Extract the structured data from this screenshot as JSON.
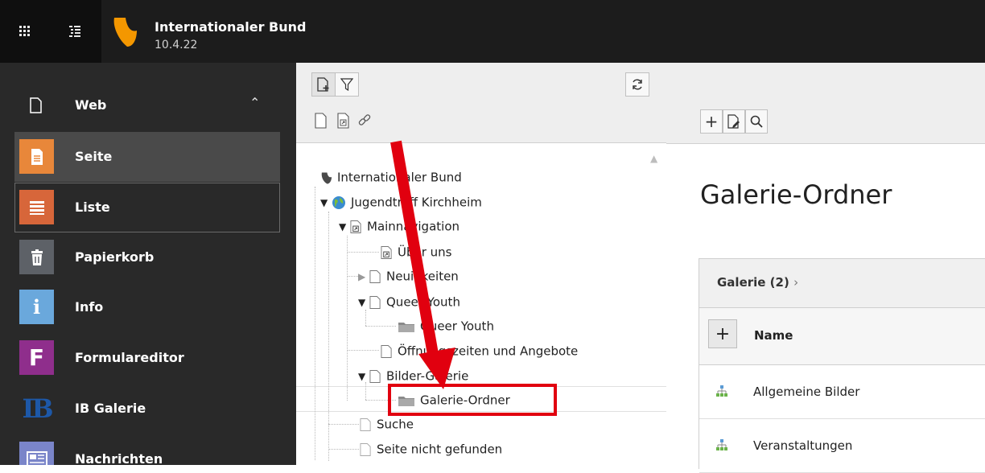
{
  "brand": {
    "name": "Internationaler Bund",
    "version": "10.4.22"
  },
  "colors": {
    "topbar": "#0f0f0f",
    "sidebar": "#292929",
    "accent_red": "#e1000f",
    "seite": "#e8873a",
    "liste": "#d7663a",
    "info": "#6aa8dc",
    "formulareditor": "#8f2e8c",
    "ib_galerie": "#1d58a8"
  },
  "sidebar": {
    "group": {
      "label": "Web",
      "icon": "page-icon",
      "expanded": true
    },
    "modules": [
      {
        "label": "Seite",
        "icon": "seite-icon",
        "state": "active"
      },
      {
        "label": "Liste",
        "icon": "liste-icon",
        "state": "hover"
      },
      {
        "label": "Papierkorb",
        "icon": "trash-icon",
        "state": "normal"
      },
      {
        "label": "Info",
        "icon": "info-icon",
        "state": "normal"
      },
      {
        "label": "Formulareditor",
        "icon": "form-icon",
        "state": "normal"
      },
      {
        "label": "IB Galerie",
        "icon": "ib-icon",
        "state": "normal"
      },
      {
        "label": "Nachrichten",
        "icon": "news-icon",
        "state": "normal"
      }
    ]
  },
  "tree": {
    "root": "Internationaler Bund",
    "site": "Jugendtreff Kirchheim",
    "nodes": {
      "main_nav": "Mainnavigation",
      "ueber_uns": "Über uns",
      "neuigkeiten": "Neuigkeiten",
      "queer_youth": "Queer Youth",
      "queer_youth_folder": "Queer Youth",
      "oeffnungszeiten": "Öffnungszeiten und Angebote",
      "bilder_galerie": "Bilder-Galerie",
      "galerie_ordner": "Galerie-Ordner",
      "suche": "Suche",
      "nicht_gefunden": "Seite nicht gefunden"
    }
  },
  "main": {
    "title": "Galerie-Ordner",
    "panel": {
      "header": "Galerie (2)",
      "column_name": "Name",
      "rows": [
        "Allgemeine Bilder",
        "Veranstaltungen"
      ]
    }
  }
}
